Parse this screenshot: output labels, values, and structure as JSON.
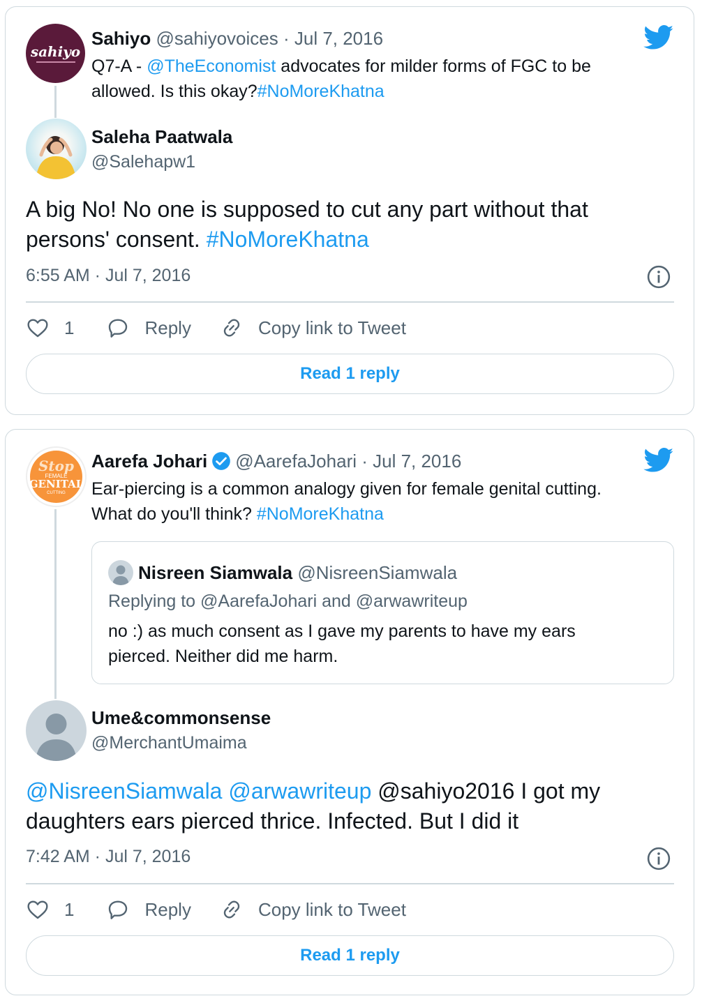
{
  "colors": {
    "accent": "#1d9bf0",
    "muted": "#536471",
    "border": "#cfd9de",
    "text": "#0f1419"
  },
  "cards": [
    {
      "parent": {
        "avatar_text": "sahiyo",
        "name": "Sahiyo",
        "handle": "@sahiyovoices",
        "date": "Jul 7, 2016",
        "text_pre": "Q7-A - ",
        "mention": "@TheEconomist",
        "text_mid": " advocates for milder forms of FGC to be",
        "text_line2": "allowed. Is this okay?",
        "hashtag": "#NoMoreKhatna"
      },
      "reply": {
        "name": "Saleha Paatwala",
        "handle": "@Salehapw1",
        "text_line1": "A big No! No one is supposed to cut any part without that",
        "text_line2": "persons' consent. ",
        "hashtag": "#NoMoreKhatna",
        "timestamp": "6:55 AM · Jul 7, 2016",
        "likes": "1",
        "reply_label": "Reply",
        "copy_label": "Copy link to Tweet",
        "read_label": "Read 1 reply"
      }
    },
    {
      "parent": {
        "avatar_lines": [
          "Stop",
          "FEMALE",
          "GENITAL",
          "CUTTING"
        ],
        "name": "Aarefa Johari",
        "handle": "@AarefaJohari",
        "date": "Jul 7, 2016",
        "text_line1": "Ear-piercing is a common analogy given for female genital cutting.",
        "text_line2": "What do you'll think? ",
        "hashtag": "#NoMoreKhatna"
      },
      "quote": {
        "name": "Nisreen Siamwala",
        "handle": "@NisreenSiamwala",
        "replying": "Replying to @AarefaJohari and @arwawriteup",
        "text_line1": "no :) as much consent as I gave my parents to have my ears",
        "text_line2": "pierced. Neither did me harm."
      },
      "reply": {
        "name": "Ume&commonsense",
        "handle": "@MerchantUmaima",
        "mention1": "@NisreenSiamwala",
        "mention2": "@arwawriteup",
        "text_line1_rest": " @sahiyo2016 I got my",
        "text_line2": "daughters ears pierced thrice. Infected. But I did it",
        "timestamp": "7:42 AM · Jul 7, 2016",
        "likes": "1",
        "reply_label": "Reply",
        "copy_label": "Copy link to Tweet",
        "read_label": "Read 1 reply"
      }
    }
  ]
}
